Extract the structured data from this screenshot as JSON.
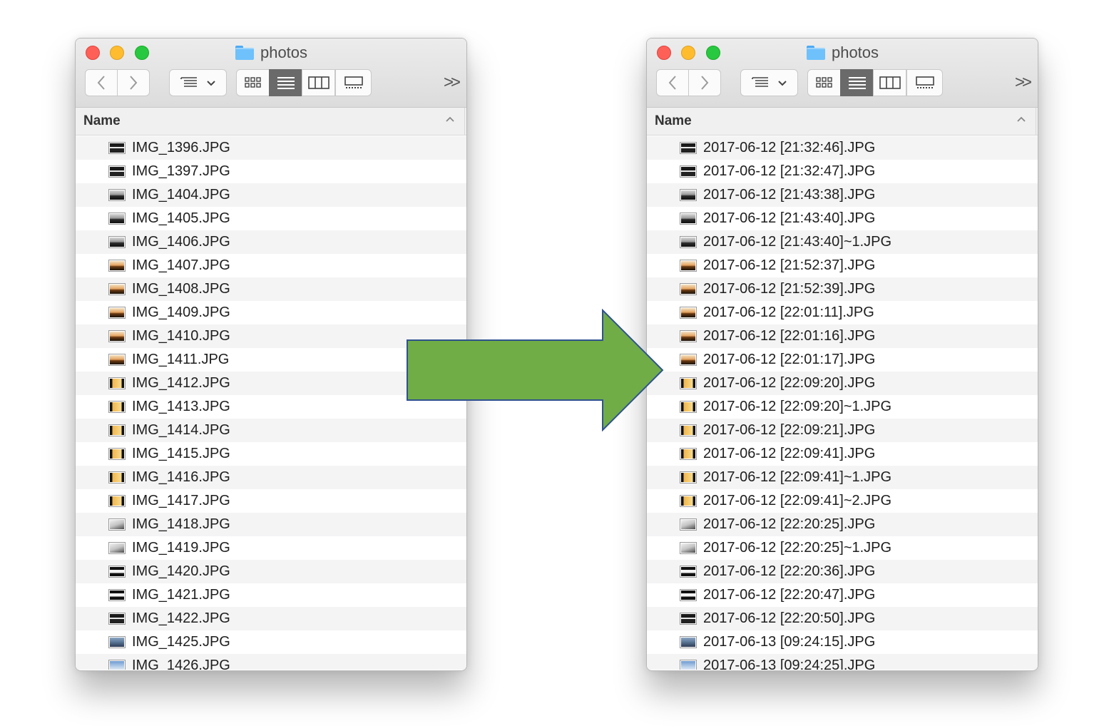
{
  "colors": {
    "arrow_fill": "#70ad47",
    "arrow_stroke": "#2f528f",
    "close": "#fe5f57",
    "minimize": "#febc2e",
    "zoom": "#28c840"
  },
  "toolbar_icons": {
    "back": "chevron-left-icon",
    "forward": "chevron-right-icon",
    "arrange": "arrange-menu-icon",
    "icon_view": "grid-view-icon",
    "list_view": "list-view-icon",
    "column_view": "column-view-icon",
    "gallery_view": "gallery-view-icon",
    "overflow": "overflow-icon"
  },
  "left": {
    "title": "photos",
    "overflow_label": ">>",
    "column_header": "Name",
    "files": [
      {
        "name": "IMG_1396.JPG",
        "thumb": "dark"
      },
      {
        "name": "IMG_1397.JPG",
        "thumb": "dark"
      },
      {
        "name": "IMG_1404.JPG",
        "thumb": "dusk"
      },
      {
        "name": "IMG_1405.JPG",
        "thumb": "dusk"
      },
      {
        "name": "IMG_1406.JPG",
        "thumb": "dusk"
      },
      {
        "name": "IMG_1407.JPG",
        "thumb": "sunset"
      },
      {
        "name": "IMG_1408.JPG",
        "thumb": "sunset"
      },
      {
        "name": "IMG_1409.JPG",
        "thumb": "sunset"
      },
      {
        "name": "IMG_1410.JPG",
        "thumb": "sunset"
      },
      {
        "name": "IMG_1411.JPG",
        "thumb": "sunset"
      },
      {
        "name": "IMG_1412.JPG",
        "thumb": "frame"
      },
      {
        "name": "IMG_1413.JPG",
        "thumb": "frame"
      },
      {
        "name": "IMG_1414.JPG",
        "thumb": "frame"
      },
      {
        "name": "IMG_1415.JPG",
        "thumb": "frame"
      },
      {
        "name": "IMG_1416.JPG",
        "thumb": "frame"
      },
      {
        "name": "IMG_1417.JPG",
        "thumb": "frame"
      },
      {
        "name": "IMG_1418.JPG",
        "thumb": "grey"
      },
      {
        "name": "IMG_1419.JPG",
        "thumb": "grey"
      },
      {
        "name": "IMG_1420.JPG",
        "thumb": "stripe"
      },
      {
        "name": "IMG_1421.JPG",
        "thumb": "stripe"
      },
      {
        "name": "IMG_1422.JPG",
        "thumb": "dark"
      },
      {
        "name": "IMG_1425.JPG",
        "thumb": "mountain"
      },
      {
        "name": "IMG_1426.JPG",
        "thumb": "sky"
      }
    ]
  },
  "right": {
    "title": "photos",
    "overflow_label": ">>",
    "column_header": "Name",
    "files": [
      {
        "name": "2017-06-12 [21:32:46].JPG",
        "thumb": "dark"
      },
      {
        "name": "2017-06-12 [21:32:47].JPG",
        "thumb": "dark"
      },
      {
        "name": "2017-06-12 [21:43:38].JPG",
        "thumb": "dusk"
      },
      {
        "name": "2017-06-12 [21:43:40].JPG",
        "thumb": "dusk"
      },
      {
        "name": "2017-06-12 [21:43:40]~1.JPG",
        "thumb": "dusk"
      },
      {
        "name": "2017-06-12 [21:52:37].JPG",
        "thumb": "sunset"
      },
      {
        "name": "2017-06-12 [21:52:39].JPG",
        "thumb": "sunset"
      },
      {
        "name": "2017-06-12 [22:01:11].JPG",
        "thumb": "sunset"
      },
      {
        "name": "2017-06-12 [22:01:16].JPG",
        "thumb": "sunset"
      },
      {
        "name": "2017-06-12 [22:01:17].JPG",
        "thumb": "sunset"
      },
      {
        "name": "2017-06-12 [22:09:20].JPG",
        "thumb": "frame"
      },
      {
        "name": "2017-06-12 [22:09:20]~1.JPG",
        "thumb": "frame"
      },
      {
        "name": "2017-06-12 [22:09:21].JPG",
        "thumb": "frame"
      },
      {
        "name": "2017-06-12 [22:09:41].JPG",
        "thumb": "frame"
      },
      {
        "name": "2017-06-12 [22:09:41]~1.JPG",
        "thumb": "frame"
      },
      {
        "name": "2017-06-12 [22:09:41]~2.JPG",
        "thumb": "frame"
      },
      {
        "name": "2017-06-12 [22:20:25].JPG",
        "thumb": "grey"
      },
      {
        "name": "2017-06-12 [22:20:25]~1.JPG",
        "thumb": "grey"
      },
      {
        "name": "2017-06-12 [22:20:36].JPG",
        "thumb": "stripe"
      },
      {
        "name": "2017-06-12 [22:20:47].JPG",
        "thumb": "stripe"
      },
      {
        "name": "2017-06-12 [22:20:50].JPG",
        "thumb": "dark"
      },
      {
        "name": "2017-06-13 [09:24:15].JPG",
        "thumb": "mountain"
      },
      {
        "name": "2017-06-13 [09:24:25].JPG",
        "thumb": "sky"
      }
    ]
  }
}
